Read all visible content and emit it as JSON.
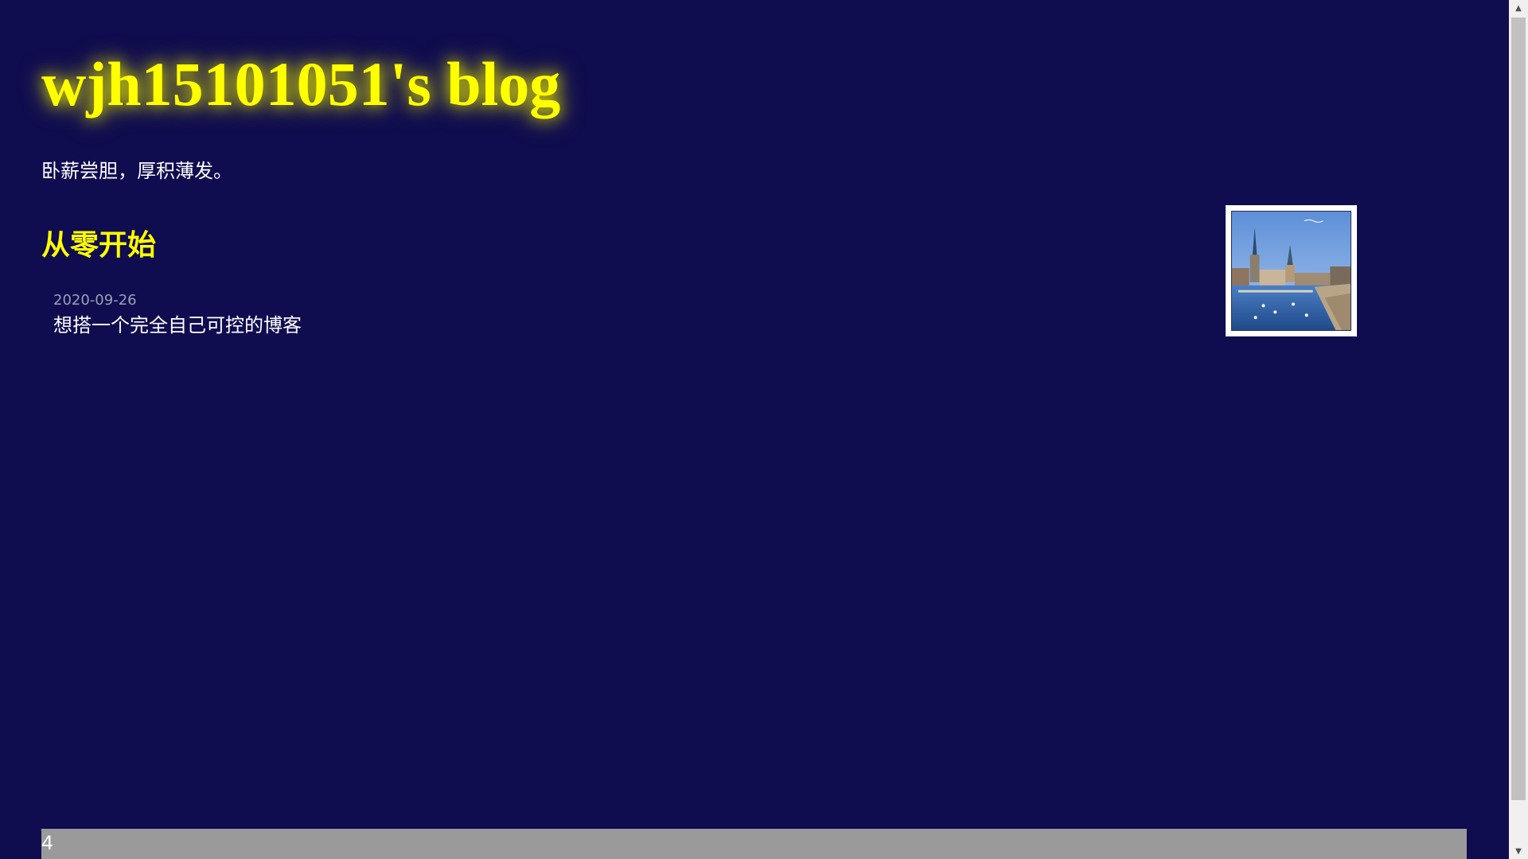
{
  "header": {
    "title": "wjh15101051's blog",
    "tagline": "卧薪尝胆，厚积薄发。"
  },
  "section": {
    "title": "从零开始"
  },
  "posts": [
    {
      "date": "2020-09-26",
      "title": "想搭一个完全自己可控的博客"
    }
  ],
  "footer": {
    "text": "4"
  },
  "colors": {
    "background": "#0f0c4f",
    "title": "#ffff00",
    "text": "#ffffff",
    "date": "#9aa0b8",
    "footer": "#9a9a9a"
  },
  "icons": {
    "scroll_up": "scroll-up-arrow-icon",
    "scroll_down": "scroll-down-arrow-icon"
  }
}
